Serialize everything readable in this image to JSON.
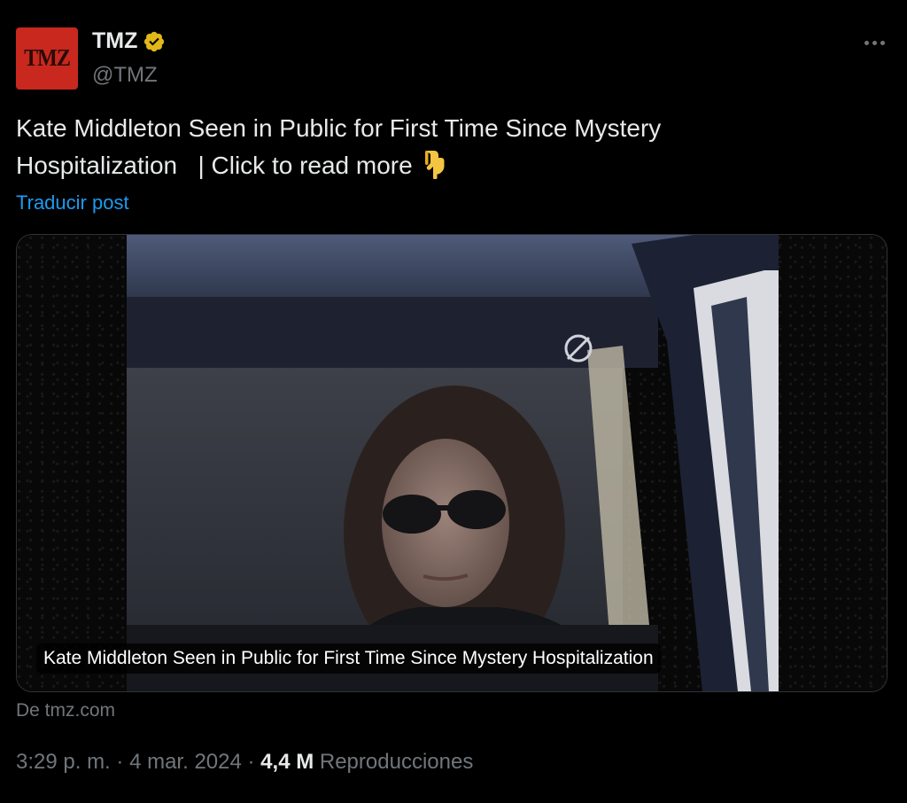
{
  "author": {
    "avatar_text": "TMZ",
    "display_name": "TMZ",
    "handle": "@TMZ",
    "verified": true,
    "verified_icon": "verified-badge-gold-icon",
    "avatar_color": "#c8281e"
  },
  "post": {
    "text_line1": "Kate Middleton Seen in Public for First Time Since Mystery",
    "text_line2": "Hospitalization",
    "separator": "|",
    "cta": "Click to read more",
    "cta_icon": "pointing-down-icon",
    "translate_label": "Traducir post"
  },
  "media": {
    "caption": "Kate Middleton Seen in Public for First Time Since Mystery Hospitalization",
    "source_label": "De tmz.com"
  },
  "meta": {
    "time": "3:29 p. m.",
    "dot1": "·",
    "date": "4 mar. 2024",
    "dot2": "·",
    "views_count": "4,4 M",
    "views_label": "Reproducciones"
  },
  "colors": {
    "background": "#000000",
    "text_primary": "#e7e9ea",
    "text_secondary": "#71767b",
    "link": "#1d9bf0",
    "verified_gold": "#e2b719"
  }
}
